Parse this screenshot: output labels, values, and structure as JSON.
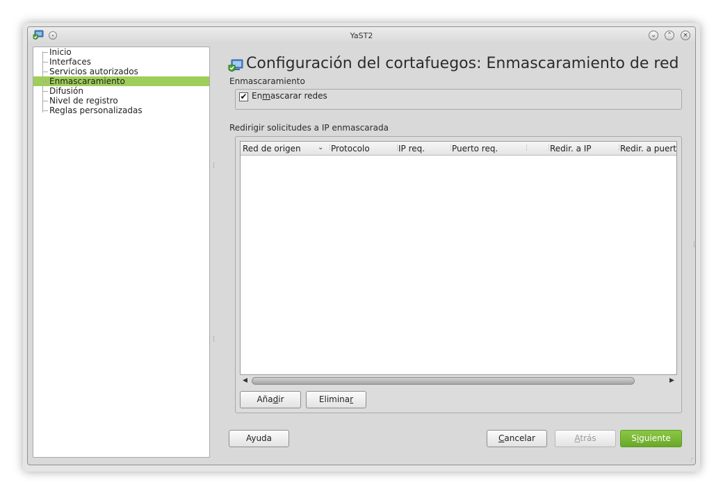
{
  "window": {
    "title": "YaST2"
  },
  "sidebar": {
    "items": [
      {
        "label": "Inicio",
        "selected": false
      },
      {
        "label": "Interfaces",
        "selected": false
      },
      {
        "label": "Servicios autorizados",
        "selected": false
      },
      {
        "label": "Enmascaramiento",
        "selected": true
      },
      {
        "label": "Difusión",
        "selected": false
      },
      {
        "label": "Nivel de registro",
        "selected": false
      },
      {
        "label": "Reglas personalizadas",
        "selected": false
      }
    ]
  },
  "main": {
    "heading": "Configuración del cortafuegos: Enmascaramiento de red",
    "masquerade_section": {
      "label": "Enmascaramiento",
      "checkbox": {
        "label_pre": "En",
        "label_mnemonic": "m",
        "label_post": "ascarar redes",
        "checked": true
      }
    },
    "redirect_section": {
      "label": "Redirigir solicitudes a IP enmascarada",
      "columns": [
        "Red de origen",
        "Protocolo",
        "IP req.",
        "Puerto req.",
        "",
        "Redir. a IP",
        "Redir. a puert"
      ],
      "rows": [],
      "add_button": {
        "pre": "Aña",
        "mnemonic": "d",
        "post": "ir"
      },
      "delete_button": {
        "pre": "Elimina",
        "mnemonic": "r",
        "post": ""
      }
    }
  },
  "footer": {
    "help_label": "Ayuda",
    "cancel_button": {
      "pre": "",
      "mnemonic": "C",
      "post": "ancelar"
    },
    "back_button": {
      "pre": "",
      "mnemonic": "A",
      "post": "trás",
      "enabled": false
    },
    "next_button": {
      "pre": "S",
      "mnemonic": "i",
      "post": "guiente"
    }
  },
  "colors": {
    "accent": "#9fcd59",
    "primary_button": "#6aa829"
  }
}
